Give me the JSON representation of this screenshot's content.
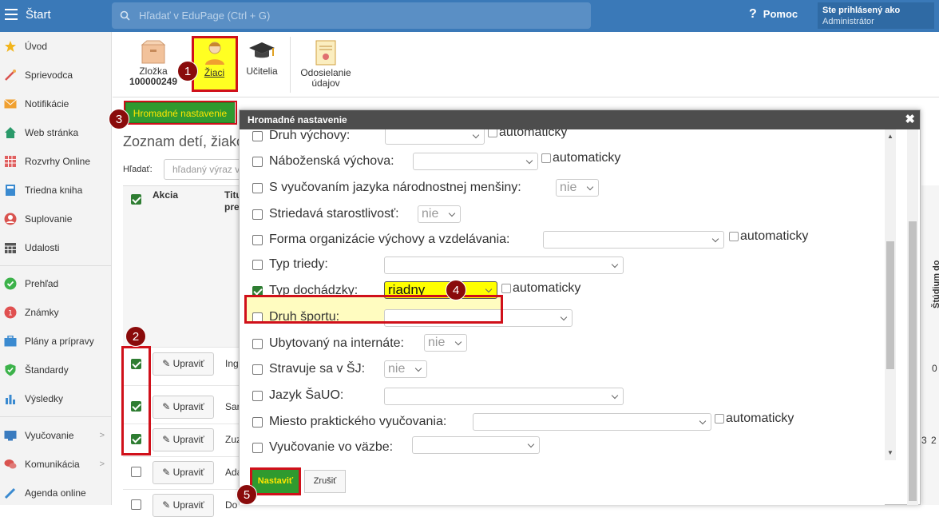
{
  "topbar": {
    "app_title": "Štart",
    "search_placeholder": "Hľadať v EduPage (Ctrl + G)",
    "help": "Pomoc",
    "user_line1": "Ste prihlásený ako",
    "user_line2": "Administrátor"
  },
  "sidebar": {
    "items": [
      {
        "label": "Úvod",
        "icon": "star-icon"
      },
      {
        "label": "Sprievodca",
        "icon": "wand-icon"
      },
      {
        "label": "Notifikácie",
        "icon": "envelope-icon"
      },
      {
        "label": "Web stránka",
        "icon": "house-icon"
      },
      {
        "label": "Rozvrhy Online",
        "icon": "grid-icon"
      },
      {
        "label": "Triedna kniha",
        "icon": "book-icon"
      },
      {
        "label": "Suplovanie",
        "icon": "person-icon"
      },
      {
        "label": "Udalosti",
        "icon": "calendar-icon"
      },
      {
        "label": "Prehľad",
        "icon": "check-circle-icon"
      },
      {
        "label": "Známky",
        "icon": "grade-icon"
      },
      {
        "label": "Plány a prípravy",
        "icon": "briefcase-icon"
      },
      {
        "label": "Štandardy",
        "icon": "shield-icon"
      },
      {
        "label": "Výsledky",
        "icon": "bar-chart-icon"
      },
      {
        "label": "Vyučovanie",
        "icon": "teach-icon"
      },
      {
        "label": "Komunikácia",
        "icon": "chat-icon"
      },
      {
        "label": "Agenda online",
        "icon": "pen-icon"
      }
    ]
  },
  "toolbar": {
    "folder_label": "Zložka",
    "folder_number": "100000249",
    "students": "Žiaci",
    "teachers": "Učitelia",
    "sending": "Odosielanie údajov"
  },
  "markers": [
    "1",
    "2",
    "3",
    "4",
    "5"
  ],
  "main": {
    "bulk_button": "Hromadné nastavenie",
    "heading": "Zoznam detí, žiakov",
    "search_label": "Hľadať:",
    "search_placeholder": "hľadaný výraz v",
    "col_action": "Akcia",
    "col_title": "Titul pred",
    "right_header": "Štúdium do",
    "right_val1": "0",
    "right_val2": "3",
    "right_val3": "2",
    "rows": [
      {
        "edit": "Upraviť",
        "name": "Ing",
        "checked": true
      },
      {
        "edit": "Upraviť",
        "name": "Sar",
        "checked": true
      },
      {
        "edit": "Upraviť",
        "name": "Zuz",
        "checked": true
      },
      {
        "edit": "Upraviť",
        "name": "Ada",
        "checked": false
      },
      {
        "edit": "Upraviť",
        "name": "Do",
        "checked": false
      }
    ]
  },
  "modal": {
    "title": "Hromadné nastavenie",
    "auto_label": "automaticky",
    "fields": [
      {
        "label": "Druh výchovy:",
        "checked": false,
        "value": ""
      },
      {
        "label": "Náboženská výchova:",
        "checked": false,
        "value": ""
      },
      {
        "label": "S vyučovaním jazyka národnostnej menšiny:",
        "checked": false,
        "value": "nie"
      },
      {
        "label": "Striedavá starostlivosť:",
        "checked": false,
        "value": "nie"
      },
      {
        "label": "Forma organizácie výchovy a vzdelávania:",
        "checked": false,
        "value": ""
      },
      {
        "label": "Typ triedy:",
        "checked": false,
        "value": ""
      },
      {
        "label": "Typ dochádzky:",
        "checked": true,
        "value": "riadny"
      },
      {
        "label": "Druh športu:",
        "checked": false,
        "value": ""
      },
      {
        "label": "Ubytovaný na internáte:",
        "checked": false,
        "value": "nie"
      },
      {
        "label": "Stravuje sa v ŠJ:",
        "checked": false,
        "value": "nie"
      },
      {
        "label": "Jazyk ŠaUO:",
        "checked": false,
        "value": ""
      },
      {
        "label": "Miesto praktického vyučovania:",
        "checked": false,
        "value": ""
      },
      {
        "label": "Vyučovanie vo väzbe:",
        "checked": false,
        "value": ""
      }
    ],
    "set_button": "Nastaviť",
    "cancel_button": "Zrušiť"
  },
  "colors": {
    "topbar": "#3a79b8",
    "accent_green": "#2f9a2f",
    "highlight_yellow": "#ffff00",
    "marker_red": "#d0101a"
  }
}
